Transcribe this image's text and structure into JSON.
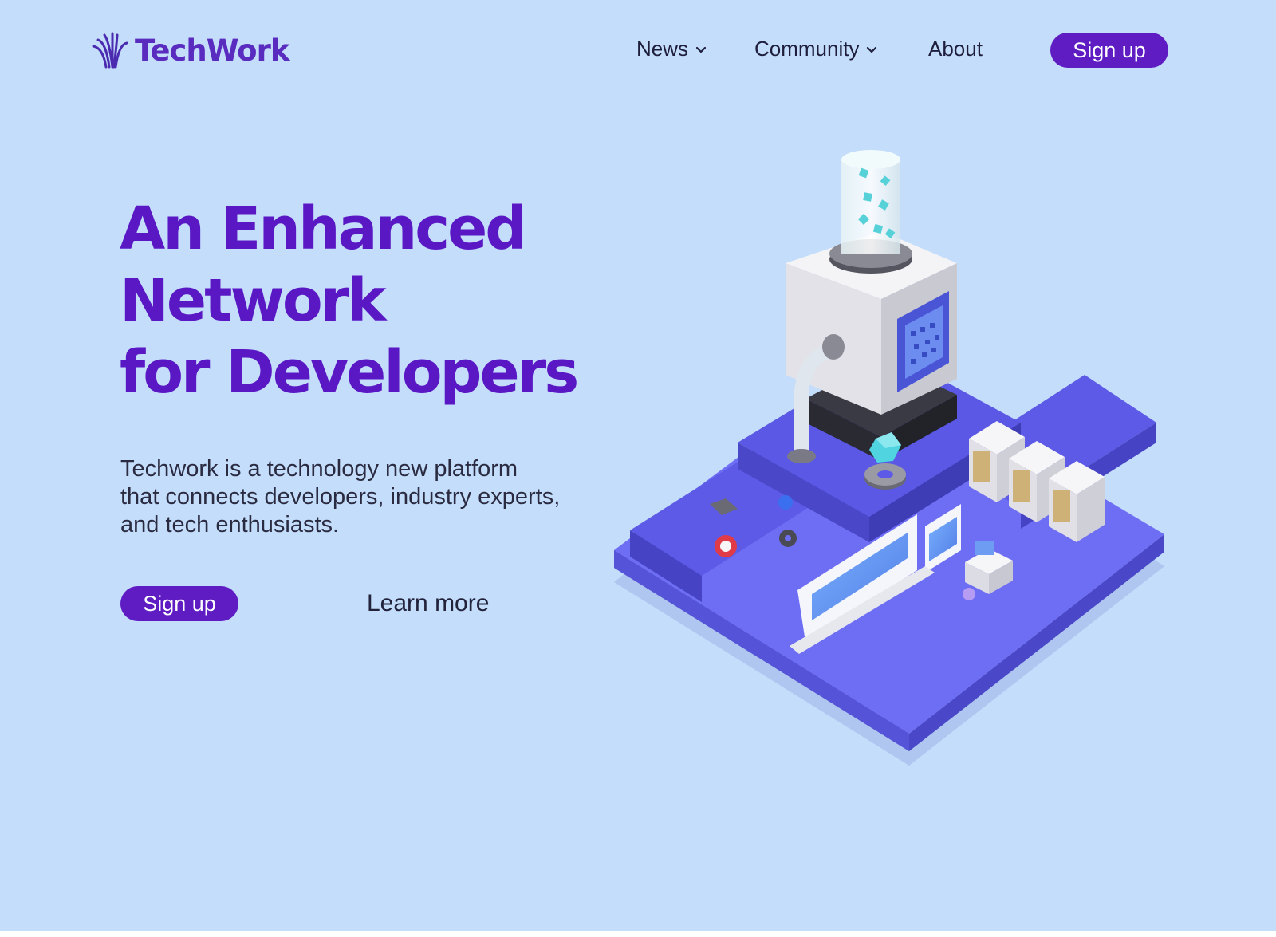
{
  "brand": {
    "name": "TechWork",
    "logo_icon": "techwork-logo-icon",
    "color": "#5a2bbf"
  },
  "nav": {
    "items": [
      {
        "label": "News",
        "has_dropdown": true
      },
      {
        "label": "Community",
        "has_dropdown": true
      },
      {
        "label": "About",
        "has_dropdown": false
      }
    ],
    "signup_label": "Sign up"
  },
  "hero": {
    "title_lines": [
      "An Enhanced",
      "Network",
      "for Developers"
    ],
    "description_lines": [
      "Techwork is a technology new platform",
      "that connects developers, industry experts,",
      "and tech enthusiasts."
    ],
    "signup_label": "Sign up",
    "learn_more_label": "Learn more"
  },
  "colors": {
    "background": "#c3ddfb",
    "accent": "#5f1cc2",
    "title": "#5a18c4",
    "platform": "#6e6ef5"
  }
}
